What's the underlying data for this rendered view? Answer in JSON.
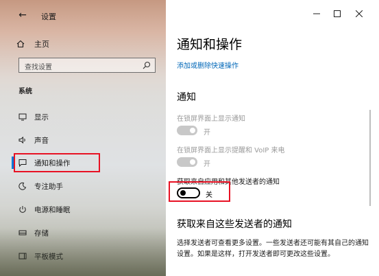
{
  "window": {
    "title": "设置",
    "controls": {
      "minimize": "—",
      "maximize": "☐",
      "close": "✕"
    }
  },
  "sidebar": {
    "back_glyph": "←",
    "home_label": "主页",
    "search_placeholder": "查找设置",
    "section": "系统",
    "items": [
      {
        "label": "显示",
        "icon": "monitor-icon"
      },
      {
        "label": "声音",
        "icon": "speaker-icon"
      },
      {
        "label": "通知和操作",
        "icon": "message-icon",
        "active": true
      },
      {
        "label": "专注助手",
        "icon": "moon-icon"
      },
      {
        "label": "电源和睡眠",
        "icon": "power-icon"
      },
      {
        "label": "存储",
        "icon": "storage-icon"
      },
      {
        "label": "平板模式",
        "icon": "tablet-icon"
      }
    ]
  },
  "main": {
    "title": "通知和操作",
    "quick_actions_link": "添加或删除快速操作",
    "notifications_heading": "通知",
    "settings": [
      {
        "label": "在锁屏界面上显示通知",
        "state": "开",
        "disabled": true,
        "on": true
      },
      {
        "label": "在锁屏界面上显示提醒和 VoIP 来电",
        "state": "开",
        "disabled": true,
        "on": true
      },
      {
        "label": "获取来自应用和其他发送者的通知",
        "state": "关",
        "disabled": false,
        "on": false
      }
    ],
    "senders_heading": "获取来自这些发送者的通知",
    "senders_desc": "选择发送者可查看更多设置。一些发送者还可能有其自己的通知设置。如果是这样，打开发送者即可更改这些设置。"
  },
  "colors": {
    "accent": "#0078d7",
    "highlight": "#e81123",
    "link": "#0067b8"
  }
}
